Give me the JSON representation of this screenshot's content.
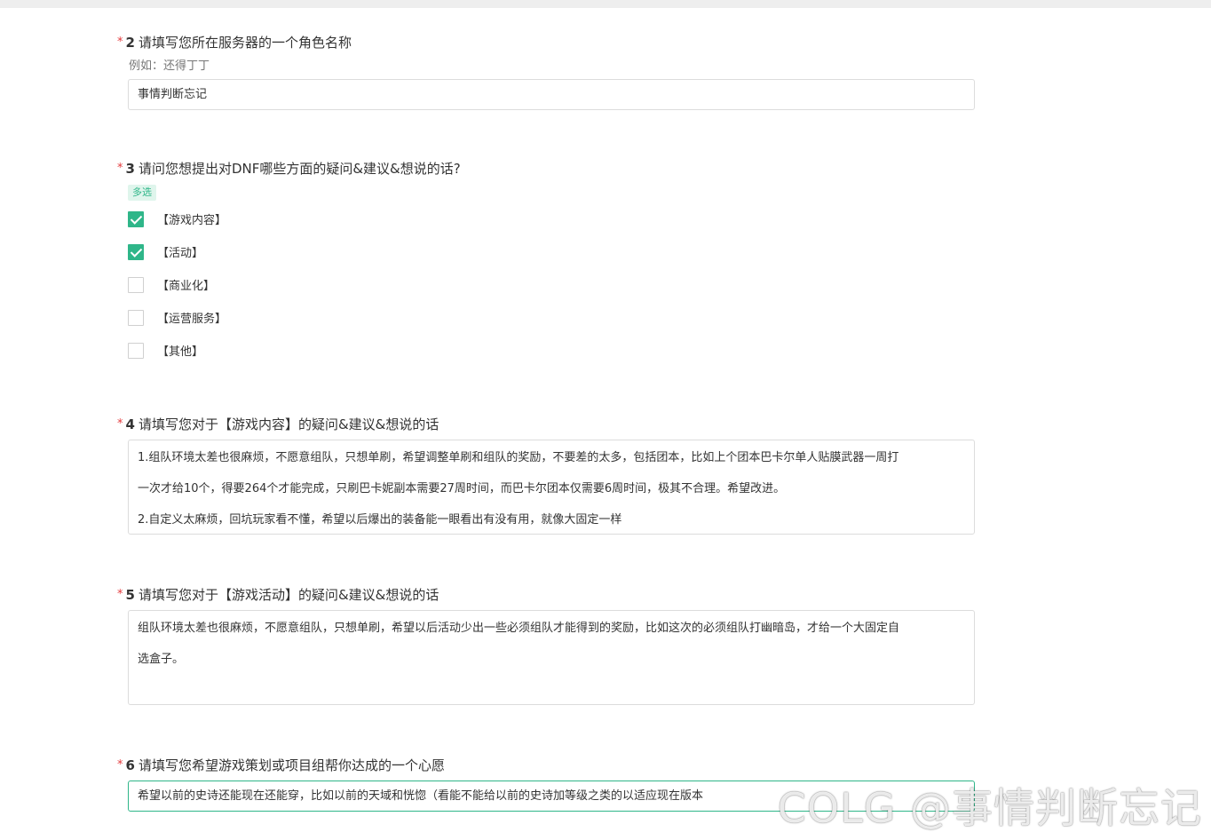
{
  "questions": [
    {
      "required_mark": "*",
      "number": "2",
      "title": "请填写您所在服务器的一个角色名称",
      "hint": "例如：还得丁丁",
      "answer": "事情判断忘记"
    },
    {
      "required_mark": "*",
      "number": "3",
      "title": "请问您想提出对DNF哪些方面的疑问&建议&想说的话?",
      "tag": "多选",
      "options": [
        {
          "label": "【游戏内容】",
          "checked": true
        },
        {
          "label": "【活动】",
          "checked": true
        },
        {
          "label": "【商业化】",
          "checked": false
        },
        {
          "label": "【运营服务】",
          "checked": false
        },
        {
          "label": "【其他】",
          "checked": false
        }
      ]
    },
    {
      "required_mark": "*",
      "number": "4",
      "title": "请填写您对于【游戏内容】的疑问&建议&想说的话",
      "answer_lines": [
        "1.组队环境太差也很麻烦，不愿意组队，只想单刷，希望调整单刷和组队的奖励，不要差的太多，包括团本，比如上个团本巴卡尔单人贴膜武器一周打",
        "一次才给10个，得要264个才能完成，只刷巴卡妮副本需要27周时间，而巴卡尔团本仅需要6周时间，极其不合理。希望改进。",
        "2.自定义太麻烦，回坑玩家看不懂，希望以后爆出的装备能一眼看出有没有用，就像大固定一样"
      ]
    },
    {
      "required_mark": "*",
      "number": "5",
      "title": "请填写您对于【游戏活动】的疑问&建议&想说的话",
      "answer_lines": [
        "组队环境太差也很麻烦，不愿意组队，只想单刷，希望以后活动少出一些必须组队才能得到的奖励，比如这次的必须组队打幽暗岛，才给一个大固定自",
        "选盒子。"
      ]
    },
    {
      "required_mark": "*",
      "number": "6",
      "title": "请填写您希望游戏策划或项目组帮你达成的一个心愿",
      "answer": "希望以前的史诗还能现在还能穿，比如以前的天域和恍惚（看能不能给以前的史诗加等级之类的以适应现在版本"
    }
  ],
  "watermark": "COLG @事情判断忘记",
  "colors": {
    "accent": "#2fb689",
    "required": "#e4393c",
    "border": "#dcdcdc"
  }
}
